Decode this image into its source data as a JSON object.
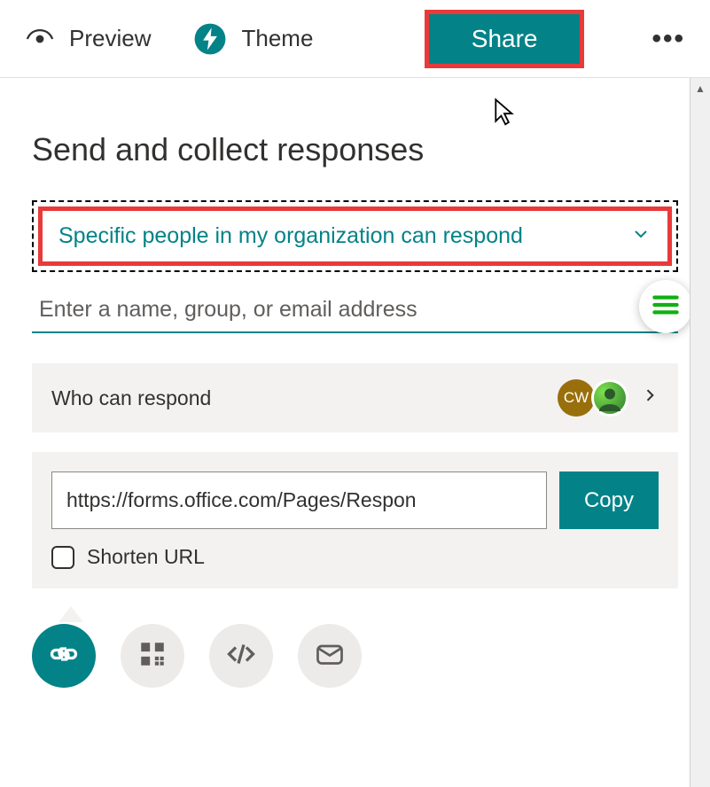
{
  "toolbar": {
    "preview_label": "Preview",
    "theme_label": "Theme",
    "share_label": "Share"
  },
  "page": {
    "title": "Send and collect responses"
  },
  "audience": {
    "selected": "Specific people in my organization can respond"
  },
  "name_input": {
    "placeholder": "Enter a name, group, or email address"
  },
  "who_row": {
    "label": "Who can respond",
    "avatar1_initials": "CW"
  },
  "link": {
    "url": "https://forms.office.com/Pages/Respon",
    "copy_label": "Copy",
    "shorten_label": "Shorten URL"
  }
}
